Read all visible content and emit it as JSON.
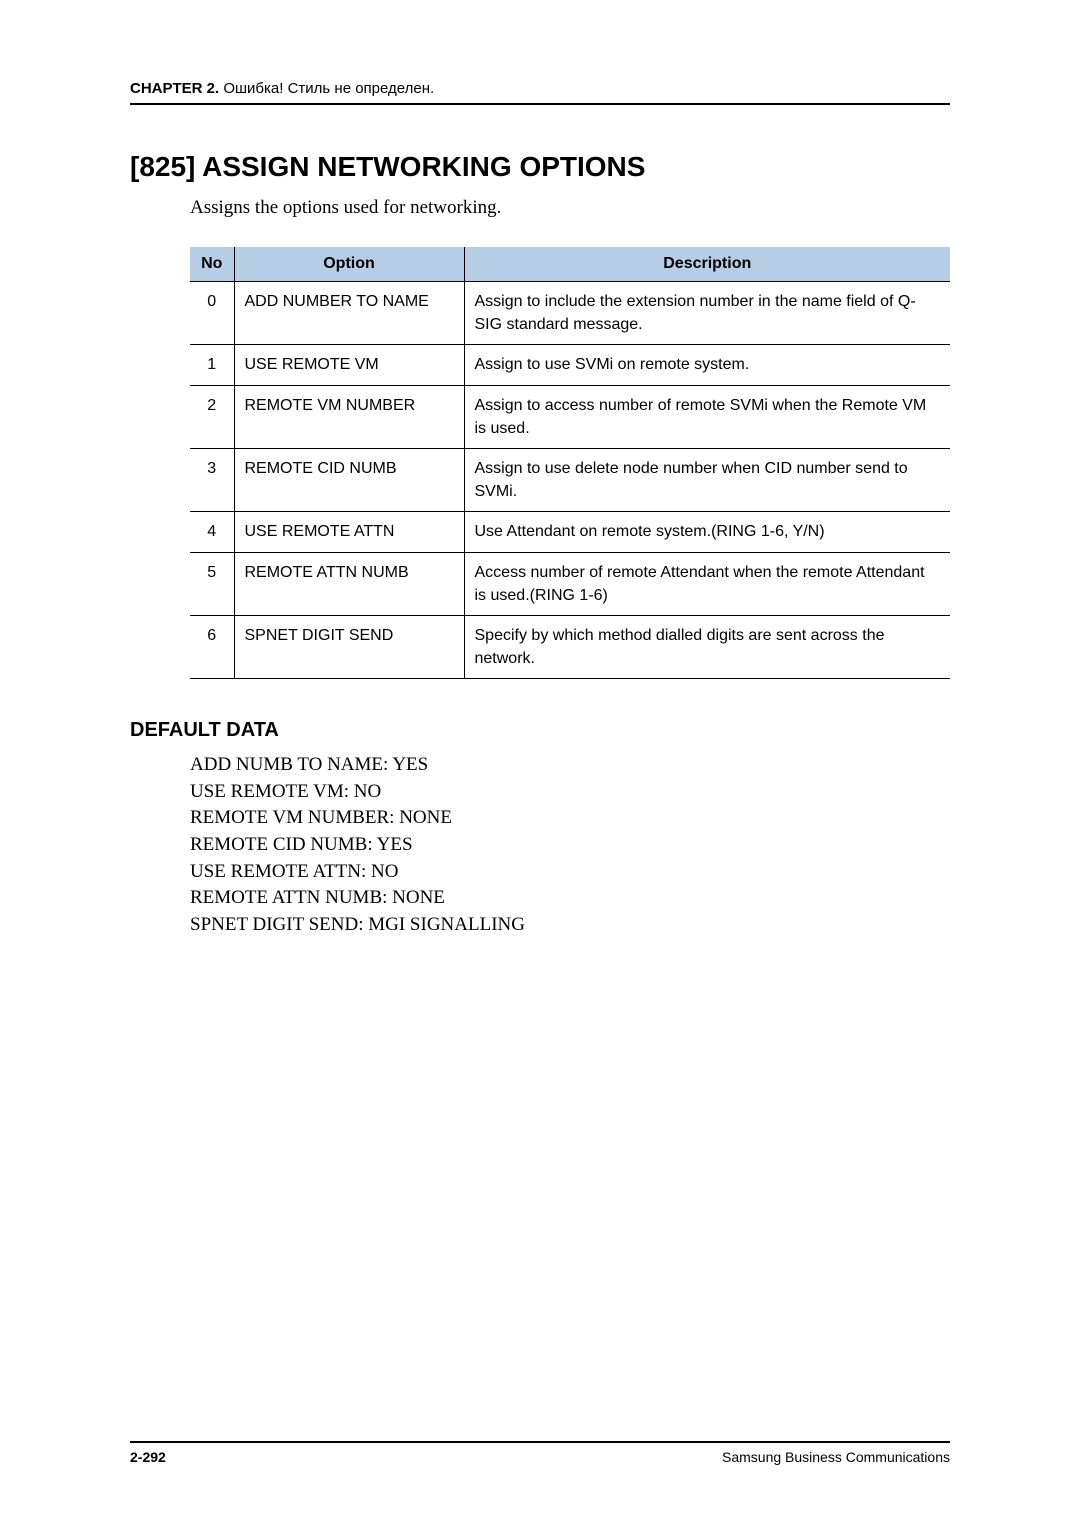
{
  "header": {
    "chapter_label": "CHAPTER 2.",
    "chapter_rest": " Ошибка! Стиль не определен."
  },
  "section": {
    "title": "[825] ASSIGN NETWORKING OPTIONS",
    "intro": "Assigns the options used for networking."
  },
  "table": {
    "headers": {
      "no": "No",
      "option": "Option",
      "description": "Description"
    },
    "rows": [
      {
        "no": "0",
        "option": "ADD NUMBER TO NAME",
        "description": "Assign to include the extension number in the name field of Q-SIG standard message."
      },
      {
        "no": "1",
        "option": "USE REMOTE VM",
        "description": "Assign to use SVMi on remote system."
      },
      {
        "no": "2",
        "option": "REMOTE VM NUMBER",
        "description": "Assign to access number of remote SVMi when the Remote VM is used."
      },
      {
        "no": "3",
        "option": "REMOTE CID NUMB",
        "description": "Assign to use delete node number when CID number send to SVMi."
      },
      {
        "no": "4",
        "option": "USE REMOTE ATTN",
        "description": "Use Attendant on remote system.(RING 1-6, Y/N)"
      },
      {
        "no": "5",
        "option": "REMOTE ATTN NUMB",
        "description": "Access number of remote Attendant when the remote Attendant is used.(RING 1-6)"
      },
      {
        "no": "6",
        "option": "SPNET DIGIT SEND",
        "description": "Specify by which method dialled digits are sent across the network."
      }
    ]
  },
  "default_data": {
    "heading": "DEFAULT DATA",
    "lines": [
      "ADD NUMB TO NAME: YES",
      "USE REMOTE VM: NO",
      "REMOTE VM NUMBER: NONE",
      "REMOTE CID NUMB: YES",
      "USE REMOTE ATTN: NO",
      "REMOTE ATTN NUMB: NONE",
      "SPNET DIGIT SEND: MGI SIGNALLING"
    ]
  },
  "footer": {
    "page": "2-292",
    "company": "Samsung Business Communications"
  }
}
